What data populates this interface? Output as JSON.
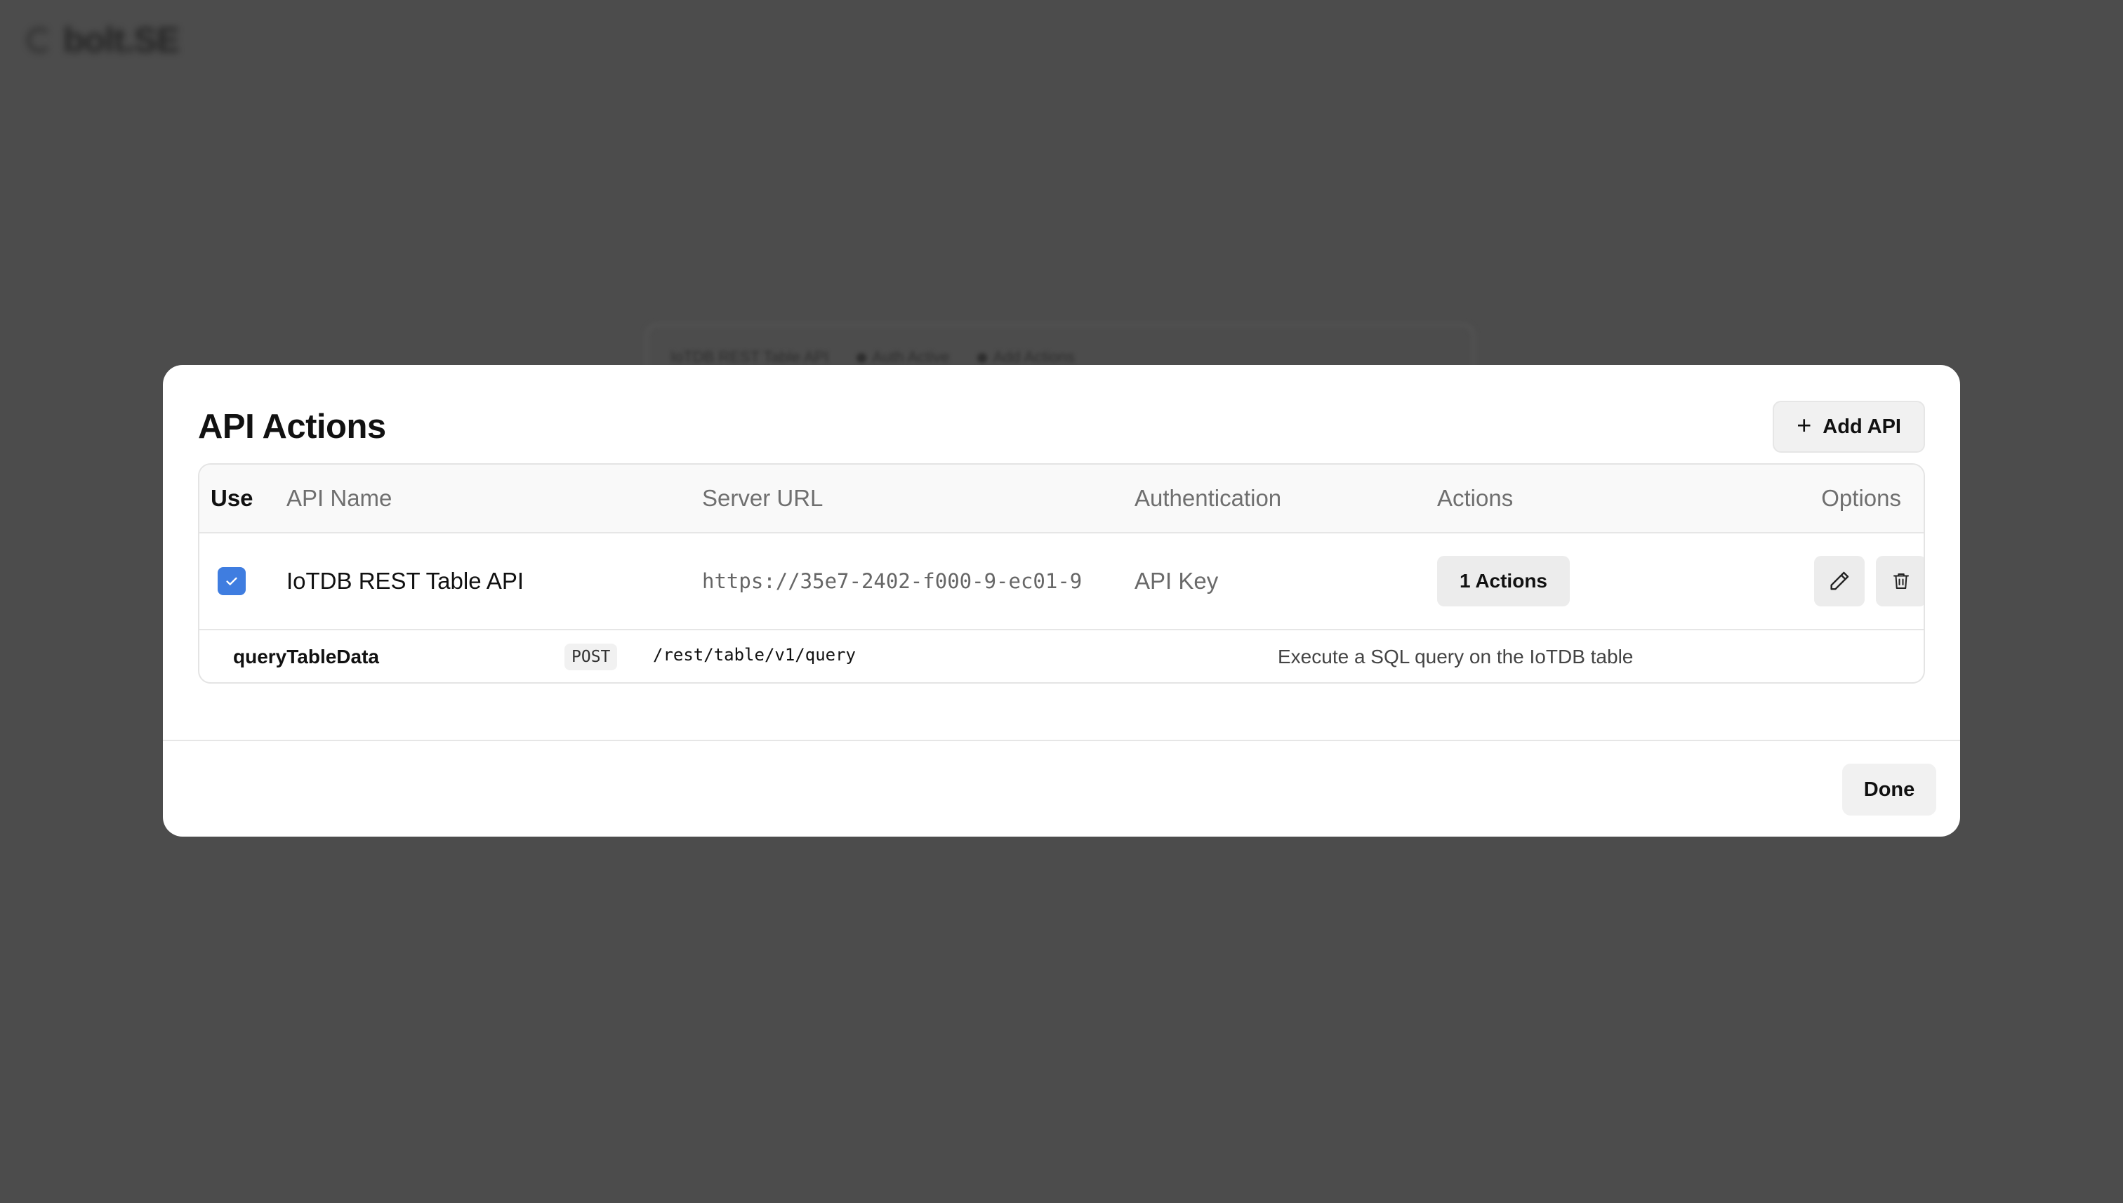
{
  "background": {
    "logo_text": "bolt.SE",
    "card_items": [
      "IoTDB REST Table API",
      "Auth Active",
      "Add Actions"
    ]
  },
  "modal": {
    "title": "API Actions",
    "add_button_label": "Add API",
    "columns": {
      "use": "Use",
      "api_name": "API Name",
      "server_url": "Server URL",
      "authentication": "Authentication",
      "actions": "Actions",
      "options": "Options"
    },
    "rows": [
      {
        "checked": true,
        "api_name": "IoTDB REST Table API",
        "server_url": "https://35e7-2402-f000-9-ec01-9…",
        "authentication": "API Key",
        "actions_label": "1 Actions",
        "operations": [
          {
            "name": "queryTableData",
            "method": "POST",
            "path": "/rest/table/v1/query",
            "description": "Execute a SQL query on the IoTDB table"
          }
        ]
      }
    ],
    "done_label": "Done"
  },
  "colors": {
    "overlay": "#4c4c4c",
    "checkbox": "#3f7de0",
    "button_bg": "#ececec"
  },
  "icons": [
    "plus-icon",
    "check-icon",
    "pencil-icon",
    "trash-icon"
  ]
}
